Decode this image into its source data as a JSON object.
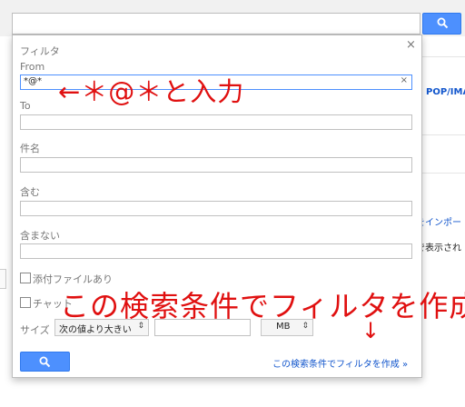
{
  "search": {
    "value": ""
  },
  "right": {
    "pop_link": "POP/IMA",
    "import_link": "をインポー",
    "display_text": "で表示され"
  },
  "dialog": {
    "title": "フィルタ",
    "close": "×",
    "from": {
      "label": "From",
      "value": "*@*",
      "clear": "×"
    },
    "to": {
      "label": "To",
      "value": ""
    },
    "subject": {
      "label": "件名",
      "value": ""
    },
    "has_words": {
      "label": "含む",
      "value": ""
    },
    "no_words": {
      "label": "含まない",
      "value": ""
    },
    "has_attachment": {
      "label": "添付ファイルあり",
      "checked": false
    },
    "chat": {
      "label": "チャット",
      "checked": false
    },
    "size": {
      "label": "サイズ",
      "op": "次の値より大きい",
      "value": "",
      "unit": "MB",
      "arrows": "⇕"
    },
    "create_filter_link": "この検索条件でフィルタを作成 »"
  },
  "annotations": {
    "from_note": "←＊@＊と入力",
    "create_note": "この検索条件でフィルタを作成",
    "arrow": "↓",
    "color": "#e01010"
  }
}
